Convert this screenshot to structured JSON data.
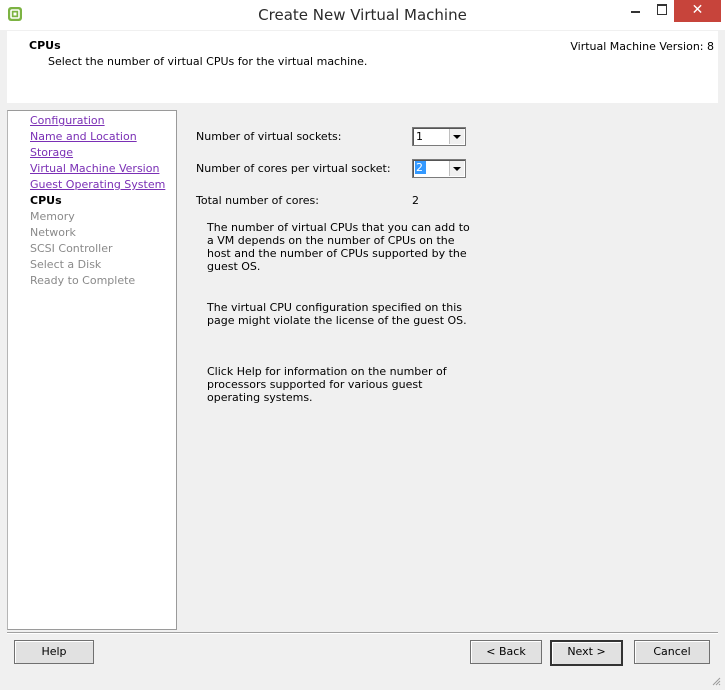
{
  "window": {
    "title": "Create New Virtual Machine",
    "close_glyph": "✕",
    "icons": [
      "vm-app-icon",
      "minimize-icon",
      "maximize-icon",
      "close-icon"
    ]
  },
  "header": {
    "title": "CPUs",
    "subtitle": "Select the number of virtual CPUs for the virtual machine.",
    "version": "Virtual Machine Version: 8"
  },
  "sidebar": {
    "items": [
      {
        "label": "Configuration",
        "state": "link"
      },
      {
        "label": "Name and Location",
        "state": "link"
      },
      {
        "label": "Storage",
        "state": "link"
      },
      {
        "label": "Virtual Machine Version",
        "state": "link"
      },
      {
        "label": "Guest Operating System",
        "state": "link"
      },
      {
        "label": "CPUs",
        "state": "current"
      },
      {
        "label": "Memory",
        "state": "disabled"
      },
      {
        "label": "Network",
        "state": "disabled"
      },
      {
        "label": "SCSI Controller",
        "state": "disabled"
      },
      {
        "label": "Select a Disk",
        "state": "disabled"
      },
      {
        "label": "Ready to Complete",
        "state": "disabled"
      }
    ]
  },
  "main": {
    "sockets_label": "Number of virtual sockets:",
    "sockets_value": "1",
    "cores_label": "Number of cores per virtual socket:",
    "cores_value": "2",
    "total_label": "Total number of cores:",
    "total_value": "2",
    "para1": "The number of virtual CPUs that you can add to a VM depends on the number of CPUs on the host and the number of CPUs supported by the guest OS.",
    "para2": "The virtual CPU configuration specified on this page might violate the license of the guest OS.",
    "para3": "Click Help for information on the number of processors supported for various guest operating systems."
  },
  "footer": {
    "help_label": "Help",
    "back_label": "< Back",
    "next_label": "Next >",
    "cancel_label": "Cancel"
  },
  "colors": {
    "link": "#7a2fb5",
    "close_button": "#c7443b",
    "selection": "#3399ff"
  }
}
